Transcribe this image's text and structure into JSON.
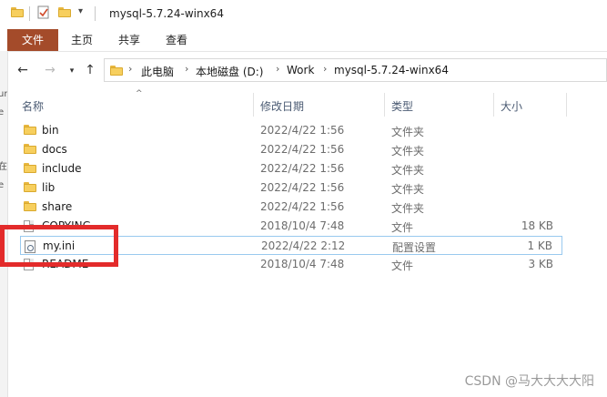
{
  "window": {
    "title": "mysql-5.7.24-winx64"
  },
  "ribbon": {
    "tabs": [
      "文件",
      "主页",
      "共享",
      "查看"
    ]
  },
  "address": {
    "crumbs": [
      "此电脑",
      "本地磁盘 (D:)",
      "Work",
      "mysql-5.7.24-winx64"
    ]
  },
  "columns": {
    "name": "名称",
    "date": "修改日期",
    "type": "类型",
    "size": "大小"
  },
  "files": [
    {
      "name": "bin",
      "date": "2022/4/22 1:56",
      "type": "文件夹",
      "size": "",
      "icon": "folder-icon"
    },
    {
      "name": "docs",
      "date": "2022/4/22 1:56",
      "type": "文件夹",
      "size": "",
      "icon": "folder-icon"
    },
    {
      "name": "include",
      "date": "2022/4/22 1:56",
      "type": "文件夹",
      "size": "",
      "icon": "folder-icon"
    },
    {
      "name": "lib",
      "date": "2022/4/22 1:56",
      "type": "文件夹",
      "size": "",
      "icon": "folder-icon"
    },
    {
      "name": "share",
      "date": "2022/4/22 1:56",
      "type": "文件夹",
      "size": "",
      "icon": "folder-icon"
    },
    {
      "name": "COPYING",
      "date": "2018/10/4 7:48",
      "type": "文件",
      "size": "18 KB",
      "icon": "file-icon"
    },
    {
      "name": "my.ini",
      "date": "2022/4/22 2:12",
      "type": "配置设置",
      "size": "1 KB",
      "icon": "ini-file-icon"
    },
    {
      "name": "README",
      "date": "2018/10/4 7:48",
      "type": "文件",
      "size": "3 KB",
      "icon": "file-icon"
    }
  ],
  "left_strip": [
    "ure",
    "e",
    "在",
    "e"
  ],
  "watermark": "CSDN @马大大大大阳",
  "colors": {
    "file_tab": "#a44b2a",
    "highlight": "#e32b2b",
    "selection_border": "#99c9ef"
  }
}
